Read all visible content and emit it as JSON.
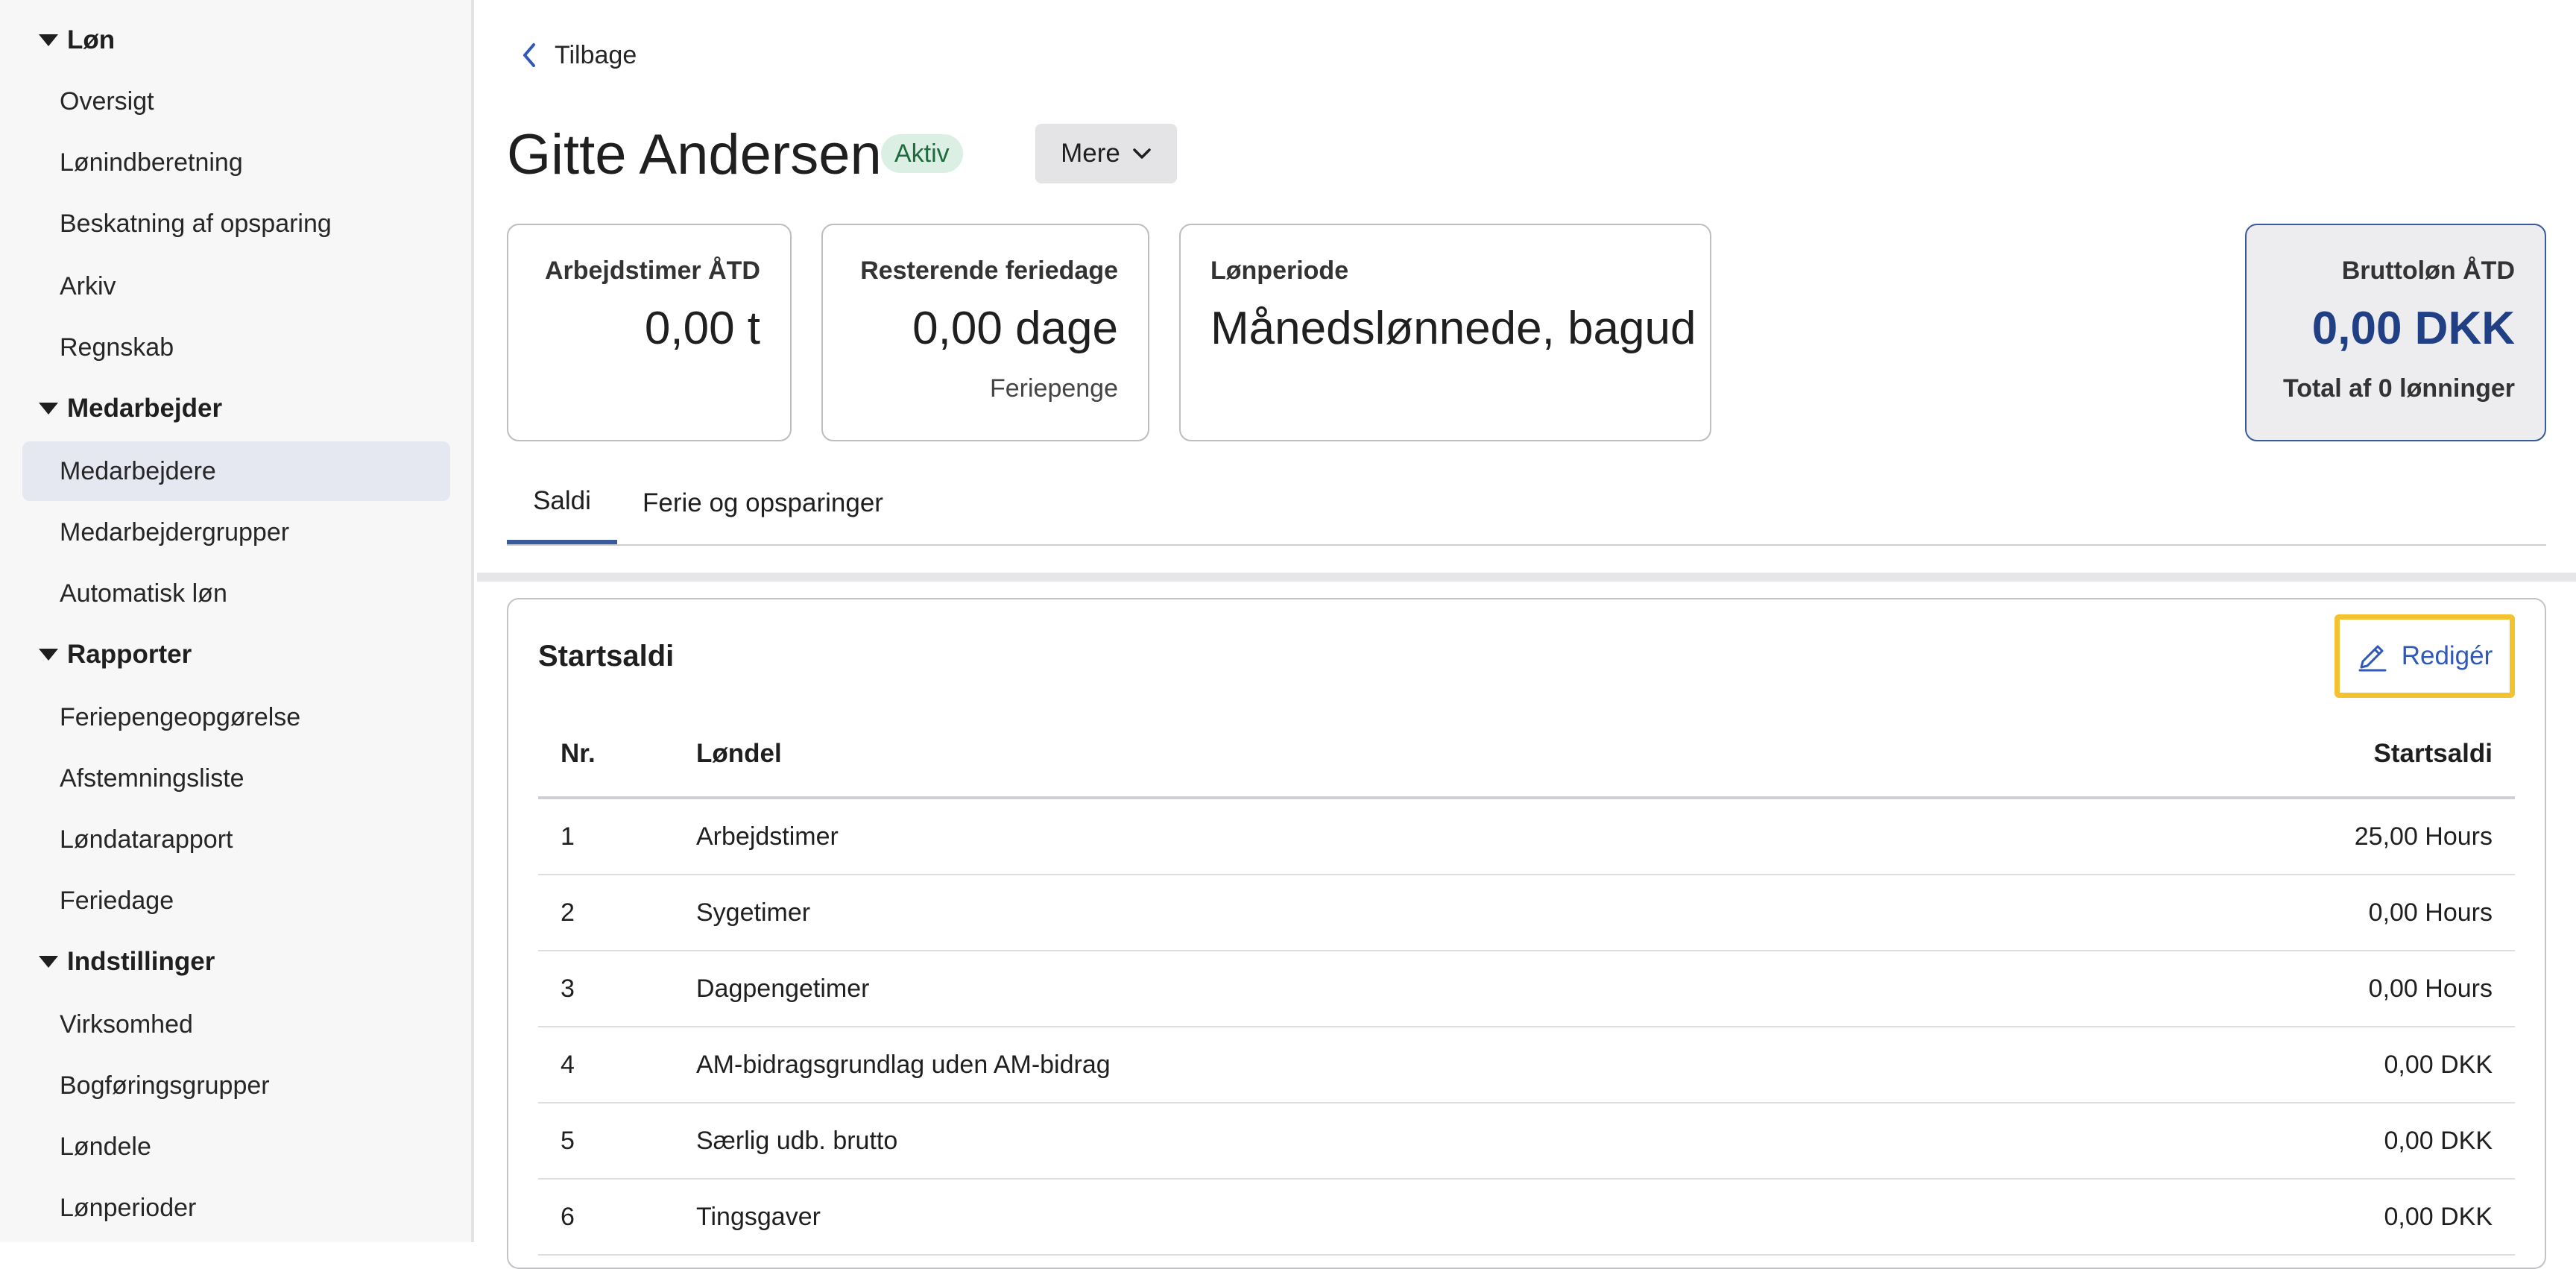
{
  "sidebar": {
    "sections": [
      {
        "title": "Løn",
        "items": [
          "Oversigt",
          "Lønindberetning",
          "Beskatning af opsparing",
          "Arkiv",
          "Regnskab"
        ]
      },
      {
        "title": "Medarbejder",
        "items": [
          "Medarbejdere",
          "Medarbejdergrupper",
          "Automatisk løn"
        ]
      },
      {
        "title": "Rapporter",
        "items": [
          "Feriepengeopgørelse",
          "Afstemningsliste",
          "Løndatarapport",
          "Feriedage"
        ]
      },
      {
        "title": "Indstillinger",
        "items": [
          "Virksomhed",
          "Bogføringsgrupper",
          "Løndele",
          "Lønperioder"
        ]
      }
    ],
    "active_item": "Medarbejdere"
  },
  "header": {
    "back_label": "Tilbage",
    "name": "Gitte Andersen",
    "status": "Aktiv",
    "more_label": "Mere"
  },
  "cards": {
    "hours": {
      "label": "Arbejdstimer ÅTD",
      "value": "0,00 t"
    },
    "vacation": {
      "label": "Resterende feriedage",
      "value": "0,00 dage",
      "sub": "Feriepenge"
    },
    "period": {
      "label": "Lønperiode",
      "value": "Månedslønnede, bagud"
    },
    "gross": {
      "label": "Bruttoløn ÅTD",
      "value": "0,00 DKK",
      "sub": "Total af 0 lønninger"
    }
  },
  "tabs": [
    "Saldi",
    "Ferie og opsparinger"
  ],
  "panel": {
    "title": "Startsaldi",
    "edit_label": "Redigér",
    "columns": {
      "nr": "Nr.",
      "name": "Løndel",
      "value": "Startsaldi"
    },
    "rows": [
      {
        "nr": "1",
        "name": "Arbejdstimer",
        "value": "25,00 Hours"
      },
      {
        "nr": "2",
        "name": "Sygetimer",
        "value": "0,00 Hours"
      },
      {
        "nr": "3",
        "name": "Dagpengetimer",
        "value": "0,00 Hours"
      },
      {
        "nr": "4",
        "name": "AM-bidragsgrundlag uden AM-bidrag",
        "value": "0,00 DKK"
      },
      {
        "nr": "5",
        "name": "Særlig udb. brutto",
        "value": "0,00 DKK"
      },
      {
        "nr": "6",
        "name": "Tingsgaver",
        "value": "0,00 DKK"
      }
    ]
  },
  "colors": {
    "accent": "#3a5a9c",
    "gross_value": "#203f85",
    "link": "#2f58b8",
    "highlight_border": "#f2c230",
    "badge_bg": "#dcefe4"
  }
}
